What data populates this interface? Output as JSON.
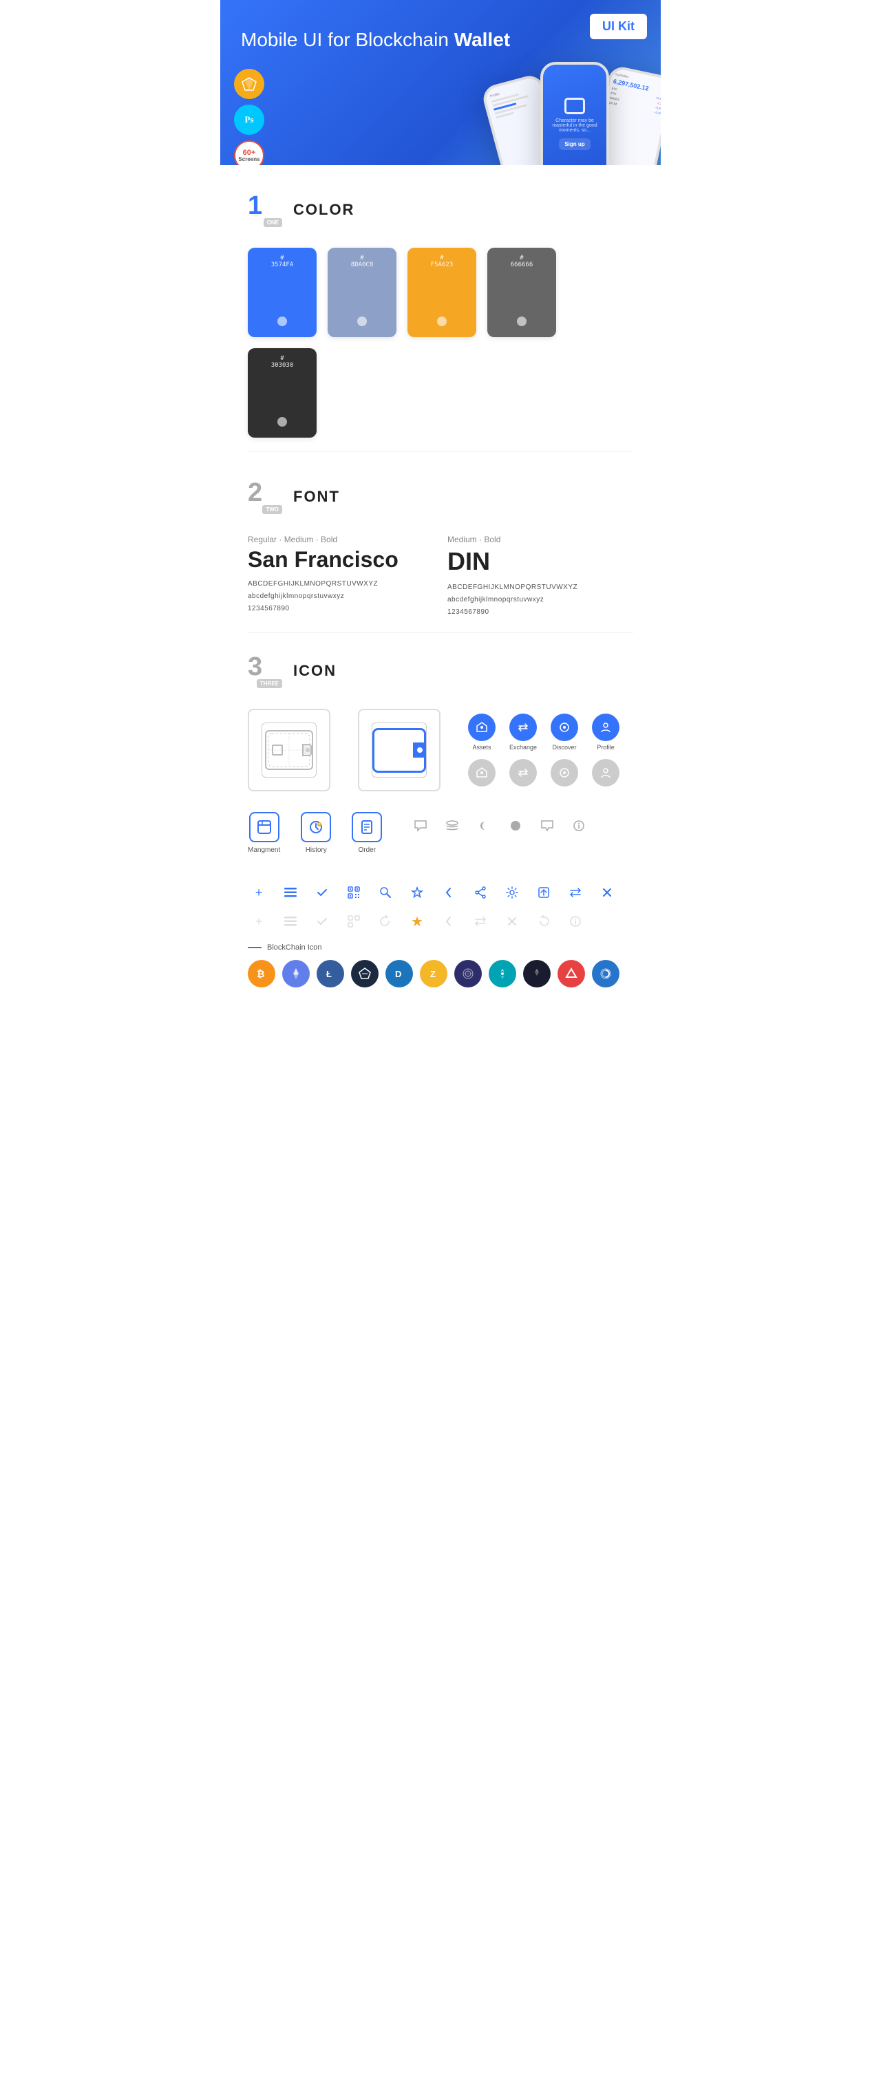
{
  "hero": {
    "title": "Mobile UI for Blockchain ",
    "title_bold": "Wallet",
    "badge": "UI Kit",
    "badges": [
      {
        "type": "sketch",
        "symbol": "◇",
        "label": "Sketch"
      },
      {
        "type": "ps",
        "symbol": "Ps",
        "label": "Photoshop"
      },
      {
        "type": "screens",
        "line1": "60+",
        "line2": "Screens"
      }
    ]
  },
  "sections": {
    "color": {
      "number": "1",
      "number_sub": "ONE",
      "title": "COLOR",
      "swatches": [
        {
          "hex": "#3574FA",
          "code": "#\n3574FA"
        },
        {
          "hex": "#8DA0C8",
          "code": "#\n8DA0C8"
        },
        {
          "hex": "#F5A623",
          "code": "#\nF5A623"
        },
        {
          "hex": "#666666",
          "code": "#\n666666"
        },
        {
          "hex": "#303030",
          "code": "#\n303030"
        }
      ]
    },
    "font": {
      "number": "2",
      "number_sub": "TWO",
      "title": "FONT",
      "fonts": [
        {
          "style": "Regular · Medium · Bold",
          "name": "San Francisco",
          "uppercase": "ABCDEFGHIJKLMNOPQRSTUVWXYZ",
          "lowercase": "abcdefghijklmnopqrstuvwxyz",
          "numbers": "1234567890"
        },
        {
          "style": "Medium · Bold",
          "name": "DIN",
          "uppercase": "ABCDEFGHIJKLMNOPQRSTUVWXYZ",
          "lowercase": "abcdefghijklmnopqrstuvwxyz",
          "numbers": "1234567890"
        }
      ]
    },
    "icon": {
      "number": "3",
      "number_sub": "THREE",
      "title": "ICON",
      "nav_icons": [
        {
          "label": "Assets",
          "symbol": "◆",
          "type": "colored"
        },
        {
          "label": "Exchange",
          "symbol": "⇌",
          "type": "colored"
        },
        {
          "label": "Discover",
          "symbol": "●",
          "type": "colored"
        },
        {
          "label": "Profile",
          "symbol": "👤",
          "type": "colored"
        }
      ],
      "nav_icons_ghost": [
        {
          "label": "",
          "symbol": "◆",
          "type": "gray"
        },
        {
          "label": "",
          "symbol": "⇌",
          "type": "gray"
        },
        {
          "label": "",
          "symbol": "●",
          "type": "gray"
        },
        {
          "label": "",
          "symbol": "👤",
          "type": "gray"
        }
      ],
      "app_icons": [
        {
          "label": "Mangment",
          "symbol": "▦"
        },
        {
          "label": "History",
          "symbol": "🕐"
        },
        {
          "label": "Order",
          "symbol": "📋"
        }
      ],
      "misc_icons_colored": [
        "+",
        "⊞",
        "✓",
        "⊞",
        "🔍",
        "☆",
        "‹",
        "≪",
        "⚙",
        "⊡",
        "⇄",
        "✕"
      ],
      "misc_icons_ghost": [
        "+",
        "⊞",
        "✓",
        "⊞",
        "↺",
        "☆",
        "‹",
        "↔",
        "✕",
        "↷",
        "ℹ"
      ],
      "blockchain_label": "BlockChain Icon",
      "crypto_icons": [
        {
          "symbol": "₿",
          "bg": "#F7931A",
          "label": "Bitcoin"
        },
        {
          "symbol": "Ξ",
          "bg": "#627EEA",
          "label": "Ethereum"
        },
        {
          "symbol": "Ł",
          "bg": "#345D9D",
          "label": "Litecoin"
        },
        {
          "symbol": "◈",
          "bg": "#1B2A41",
          "label": "WAVES"
        },
        {
          "symbol": "D",
          "bg": "#1C75BC",
          "label": "Dash"
        },
        {
          "symbol": "Z",
          "bg": "#ECB244",
          "label": "Zcash"
        },
        {
          "symbol": "✦",
          "bg": "#2D2D6A",
          "label": "Grid"
        },
        {
          "symbol": "▲",
          "bg": "#00A3B4",
          "label": "ADA"
        },
        {
          "symbol": "▲",
          "bg": "#1B1B2F",
          "label": "Dark"
        },
        {
          "symbol": "⬡",
          "bg": "#E84142",
          "label": "AVAX"
        },
        {
          "symbol": "◐",
          "bg": "#2775CA",
          "label": "USDC"
        }
      ],
      "misc_icons_middle": [
        "💬",
        "≡≡",
        "☾",
        "●",
        "💬",
        "ℹ"
      ]
    }
  }
}
